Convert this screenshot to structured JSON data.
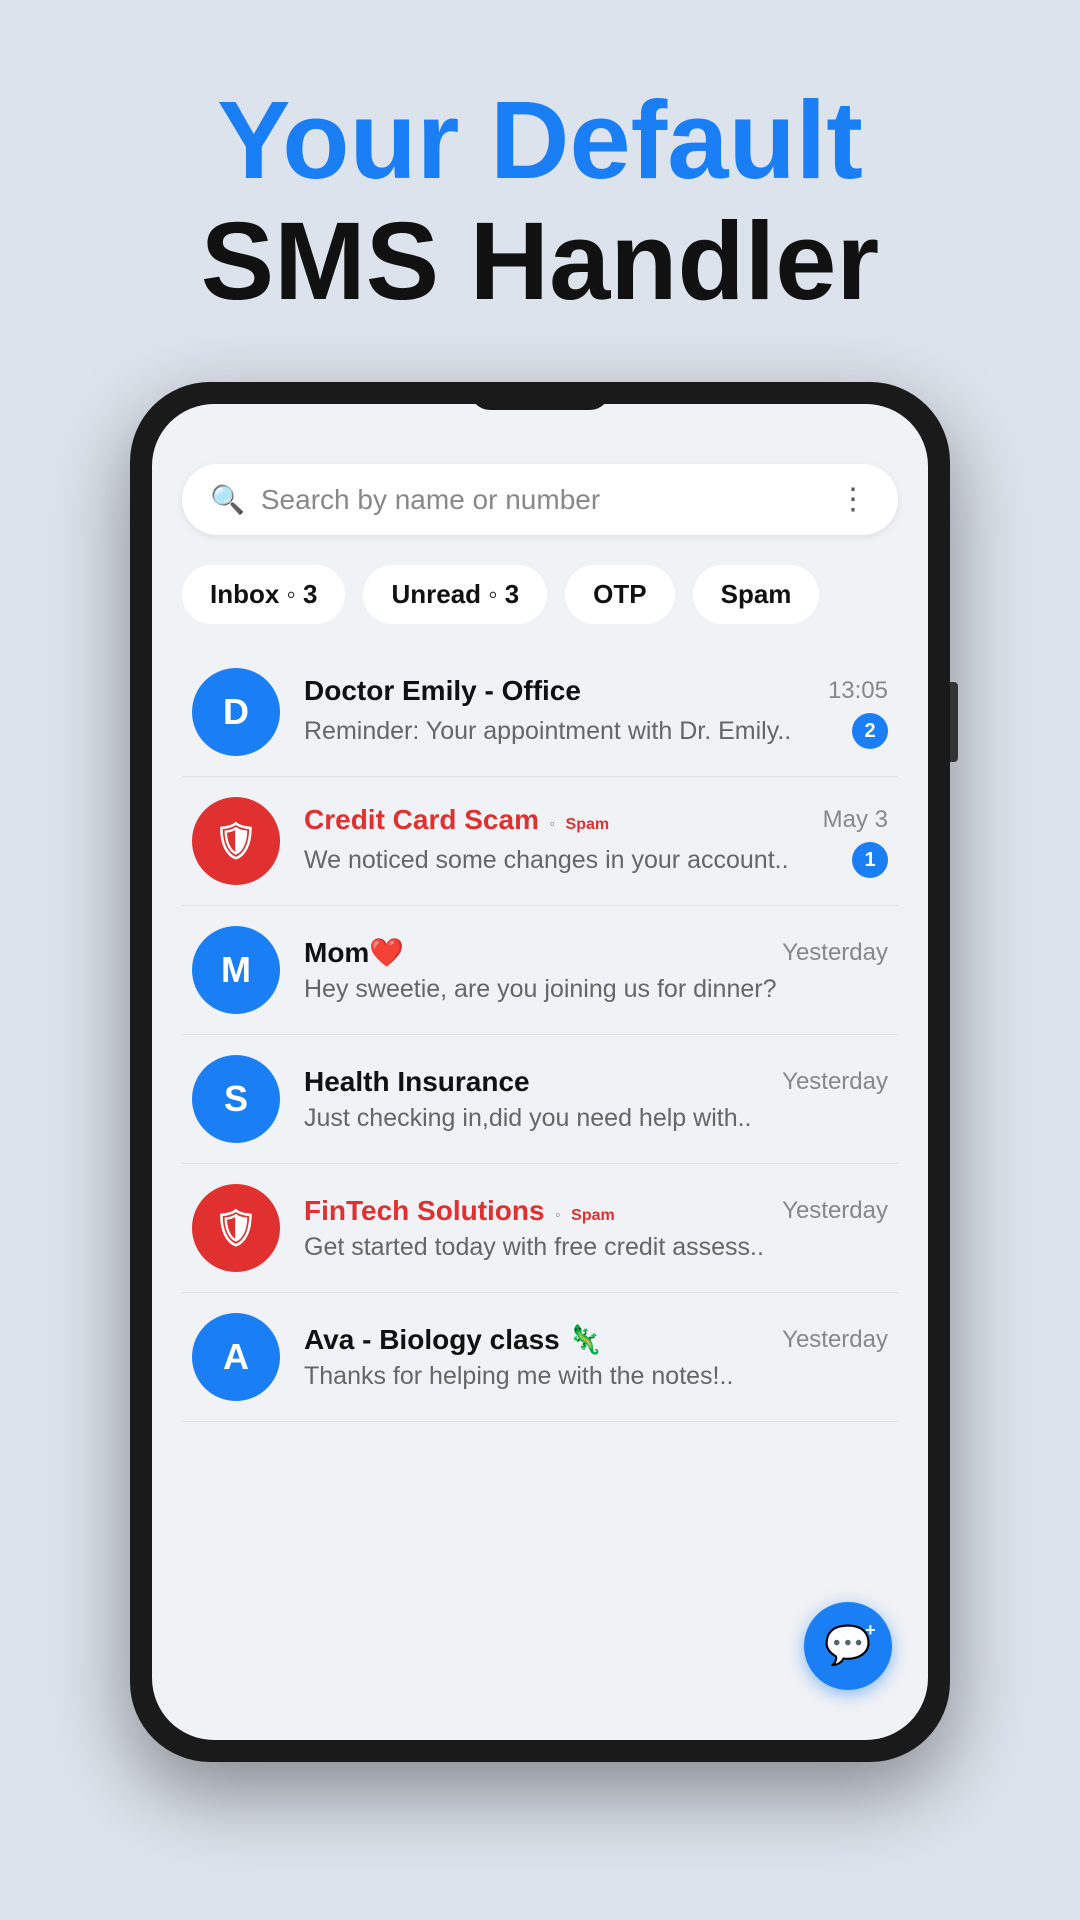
{
  "headline": {
    "line1": "Your Default",
    "line2": "SMS Handler"
  },
  "search": {
    "placeholder": "Search by name or number"
  },
  "tabs": [
    {
      "id": "inbox",
      "label": "Inbox",
      "count": "3"
    },
    {
      "id": "unread",
      "label": "Unread",
      "count": "3"
    },
    {
      "id": "otp",
      "label": "OTP",
      "count": ""
    },
    {
      "id": "spam",
      "label": "Spam",
      "count": ""
    }
  ],
  "messages": [
    {
      "id": "doctor-emily",
      "avatarLetter": "D",
      "avatarType": "blue",
      "name": "Doctor Emily - Office",
      "isSpam": false,
      "time": "13:05",
      "preview": "Reminder: Your appointment with Dr. Emily..",
      "unread": 2
    },
    {
      "id": "credit-card-scam",
      "avatarLetter": "shield",
      "avatarType": "red",
      "name": "Credit Card Scam",
      "isSpam": true,
      "spamLabel": "Spam",
      "time": "May 3",
      "preview": "We noticed some changes in your account..",
      "unread": 1
    },
    {
      "id": "mom",
      "avatarLetter": "M",
      "avatarType": "blue",
      "name": "Mom❤️",
      "isSpam": false,
      "time": "Yesterday",
      "preview": "Hey sweetie, are you joining us for dinner?",
      "unread": 0
    },
    {
      "id": "health-insurance",
      "avatarLetter": "S",
      "avatarType": "blue",
      "name": "Health Insurance",
      "isSpam": false,
      "time": "Yesterday",
      "preview": "Just checking in,did you need help with..",
      "unread": 0
    },
    {
      "id": "fintech-solutions",
      "avatarLetter": "shield",
      "avatarType": "red",
      "name": "FinTech Solutions",
      "isSpam": true,
      "spamLabel": "Spam",
      "time": "Yesterday",
      "preview": "Get started today with free credit assess..",
      "unread": 0
    },
    {
      "id": "ava-biology",
      "avatarLetter": "A",
      "avatarType": "blue",
      "name": "Ava - Biology class 🦎",
      "isSpam": false,
      "time": "Yesterday",
      "preview": "Thanks for helping me with the notes!..",
      "unread": 0
    }
  ],
  "fab": {
    "icon": "💬",
    "ariaLabel": "New Message"
  }
}
